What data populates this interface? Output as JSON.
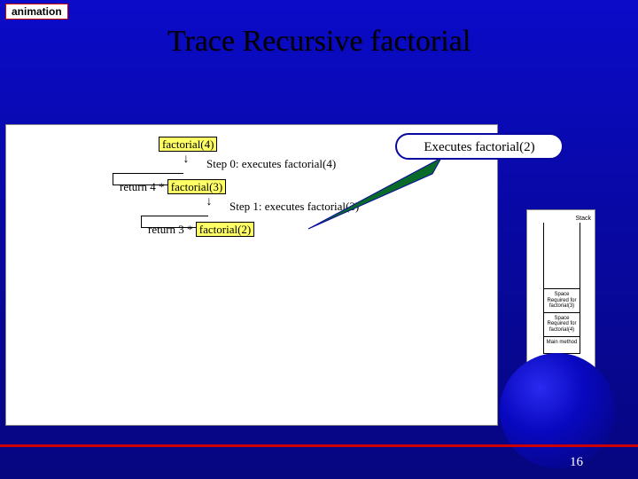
{
  "tag": {
    "label": "animation"
  },
  "title": "Trace Recursive factorial",
  "callout": {
    "text": "Executes factorial(2)"
  },
  "trace": {
    "root": "factorial(4)",
    "step0": "Step 0: executes factorial(4)",
    "ret0a": "return 4 * ",
    "ret0b": "factorial(3)",
    "step1": "Step 1: executes factorial(3)",
    "ret1a": "return 3 * ",
    "ret1b": "factorial(2)"
  },
  "stack": {
    "title": "Stack",
    "cells": [
      "Space Required for factorial(3)",
      "Space Required for factorial(4)",
      "Main method"
    ]
  },
  "page": "16"
}
